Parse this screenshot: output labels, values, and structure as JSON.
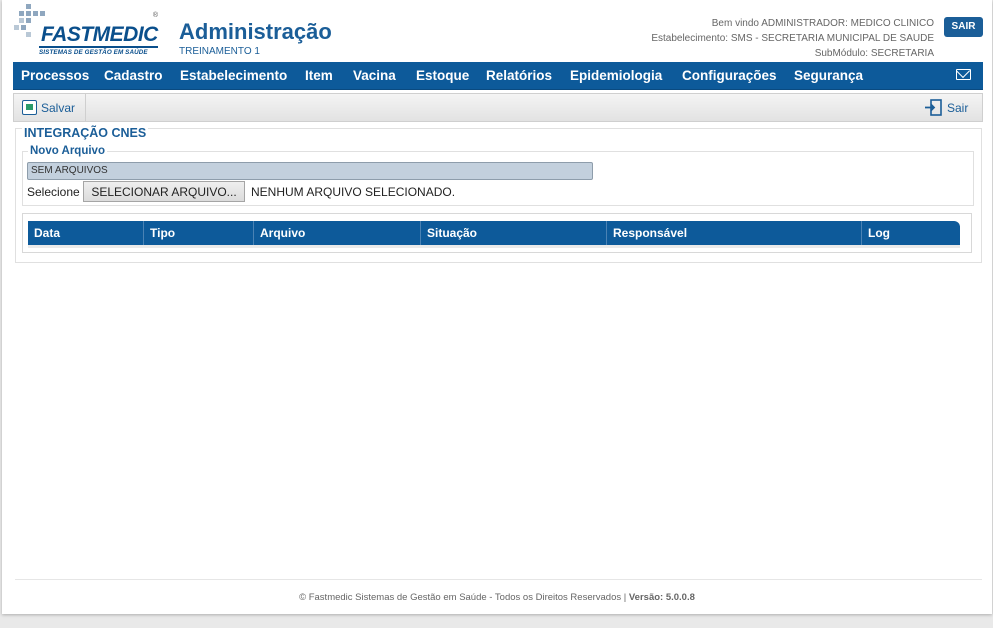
{
  "brand": {
    "name": "FASTMEDIC",
    "registered": "®",
    "tagline": "SISTEMAS DE GESTÃO EM SAÚDE"
  },
  "header": {
    "title": "Administração",
    "subtitle": "TREINAMENTO 1",
    "welcome": "Bem vindo ADMINISTRADOR: MEDICO CLINICO",
    "establishment": "Estabelecimento: SMS - SECRETARIA MUNICIPAL DE SAUDE",
    "submodule": "SubMódulo: SECRETARIA",
    "logout_label": "SAIR"
  },
  "menu": {
    "items": [
      "Processos",
      "Cadastro",
      "Estabelecimento",
      "Item",
      "Vacina",
      "Estoque",
      "Relatórios",
      "Epidemiologia",
      "Configurações",
      "Segurança"
    ],
    "mail_icon": "envelope-icon"
  },
  "toolbar": {
    "save_label": "Salvar",
    "exit_label": "Sair"
  },
  "panel": {
    "title": "INTEGRAÇÃO CNES",
    "new_file": {
      "legend": "Novo Arquivo",
      "status": "SEM ARQUIVOS",
      "select_label": "Selecione",
      "select_button": "SELECIONAR ARQUIVO...",
      "no_file": "NENHUM ARQUIVO SELECIONADO."
    },
    "table": {
      "columns": [
        "Data",
        "Tipo",
        "Arquivo",
        "Situação",
        "Responsável",
        "Log"
      ],
      "rows": []
    }
  },
  "footer": {
    "text": "© Fastmedic Sistemas de Gestão em Saúde - Todos os Direitos Reservados |",
    "version": "Versão: 5.0.0.8"
  },
  "colors": {
    "primary": "#0d5a9a",
    "accent_text": "#1b5e98",
    "status_field": "#c3d0dd"
  }
}
